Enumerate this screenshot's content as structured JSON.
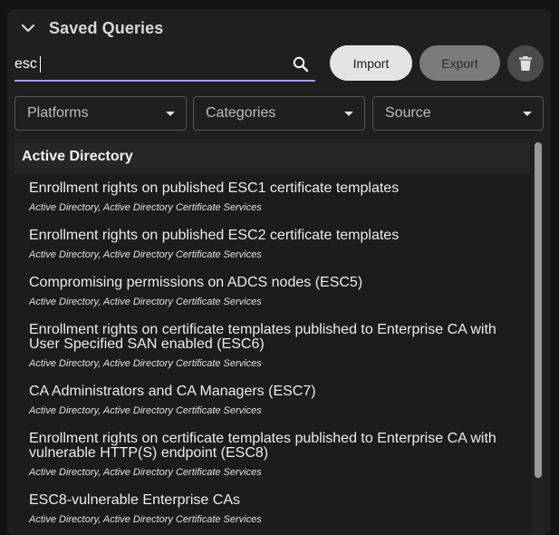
{
  "panel": {
    "title": "Saved Queries"
  },
  "search": {
    "value": "esc",
    "placeholder": ""
  },
  "buttons": {
    "import": "Import",
    "export": "Export"
  },
  "filters": [
    "Platforms",
    "Categories",
    "Source"
  ],
  "groups": [
    {
      "title": "Active Directory",
      "items": [
        {
          "name": "Enrollment rights on published ESC1 certificate templates",
          "tags": "Active Directory, Active Directory Certificate Services"
        },
        {
          "name": "Enrollment rights on published ESC2 certificate templates",
          "tags": "Active Directory, Active Directory Certificate Services"
        },
        {
          "name": "Compromising permissions on ADCS nodes (ESC5)",
          "tags": "Active Directory, Active Directory Certificate Services"
        },
        {
          "name": "Enrollment rights on certificate templates published to Enterprise CA with User Specified SAN enabled (ESC6)",
          "tags": "Active Directory, Active Directory Certificate Services"
        },
        {
          "name": "CA Administrators and CA Managers (ESC7)",
          "tags": "Active Directory, Active Directory Certificate Services"
        },
        {
          "name": "Enrollment rights on certificate templates published to Enterprise CA with vulnerable HTTP(S) endpoint (ESC8)",
          "tags": "Active Directory, Active Directory Certificate Services"
        },
        {
          "name": "ESC8-vulnerable Enterprise CAs",
          "tags": "Active Directory, Active Directory Certificate Services"
        }
      ]
    }
  ],
  "icons": {
    "collapse": "chevron-down-icon",
    "search": "search-icon",
    "delete": "trash-icon",
    "dropdown": "caret-down-icon"
  },
  "colors": {
    "accent": "#a59de8",
    "import_bg": "#e4e4e4",
    "export_bg": "#7b7b7b"
  }
}
